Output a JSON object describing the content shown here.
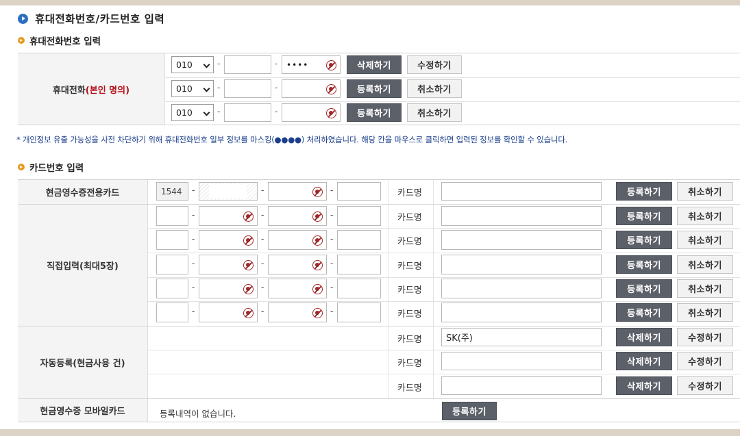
{
  "page": {
    "title": "휴대전화번호/카드번호 입력",
    "phone_section_title": "휴대전화번호 입력",
    "card_section_title": "카드번호 입력",
    "notice": "* 개인정보 유출 가능성을 사전 차단하기 위해 휴대전화번호 일부 정보를 마스킹(●●●●) 처리하였습니다. 해당 칸을 마우스로 클릭하면 입력된 정보를 확인할 수 있습니다."
  },
  "phone": {
    "label_main": "휴대전화",
    "label_highlight": "(본인 명의)",
    "dash": "-",
    "rows": [
      {
        "prefix": "010",
        "middle": "",
        "last": "••••",
        "primary_btn": "삭제하기",
        "secondary_btn": "수정하기"
      },
      {
        "prefix": "010",
        "middle": "",
        "last": "",
        "primary_btn": "등록하기",
        "secondary_btn": "취소하기"
      },
      {
        "prefix": "010",
        "middle": "",
        "last": "",
        "primary_btn": "등록하기",
        "secondary_btn": "취소하기"
      }
    ]
  },
  "card": {
    "cardname_label": "카드명",
    "dash": "-",
    "cash_receipt_card": {
      "label": "현금영수증전용카드",
      "prefix": "1544",
      "card_name": "",
      "primary_btn": "등록하기",
      "secondary_btn": "취소하기"
    },
    "direct_input": {
      "label": "직접입력(최대5장)",
      "rows": [
        {
          "card_name": "",
          "primary_btn": "등록하기",
          "secondary_btn": "취소하기"
        },
        {
          "card_name": "",
          "primary_btn": "등록하기",
          "secondary_btn": "취소하기"
        },
        {
          "card_name": "",
          "primary_btn": "등록하기",
          "secondary_btn": "취소하기"
        },
        {
          "card_name": "",
          "primary_btn": "등록하기",
          "secondary_btn": "취소하기"
        },
        {
          "card_name": "",
          "primary_btn": "등록하기",
          "secondary_btn": "취소하기"
        }
      ]
    },
    "auto_register": {
      "label": "자동등록(현금사용 건)",
      "rows": [
        {
          "card_name": "SK(주)",
          "primary_btn": "삭제하기",
          "secondary_btn": "수정하기"
        },
        {
          "card_name": "",
          "primary_btn": "삭제하기",
          "secondary_btn": "수정하기"
        },
        {
          "card_name": "",
          "primary_btn": "삭제하기",
          "secondary_btn": "수정하기"
        }
      ]
    },
    "mobile_card": {
      "label": "현금영수증 모바일카드",
      "status": "등록내역이 없습니다.",
      "primary_btn": "등록하기"
    }
  },
  "colors": {
    "accent_blue": "#2e6fbf",
    "bullet_orange": "#e89b22",
    "highlight_red": "#b5121b",
    "button_dark": "#5c6069",
    "notice_text": "#1b3f8c"
  },
  "icons": [
    "arrow-circle-icon",
    "bullet-icon",
    "chevron-down-icon",
    "eye-toggle-icon"
  ]
}
